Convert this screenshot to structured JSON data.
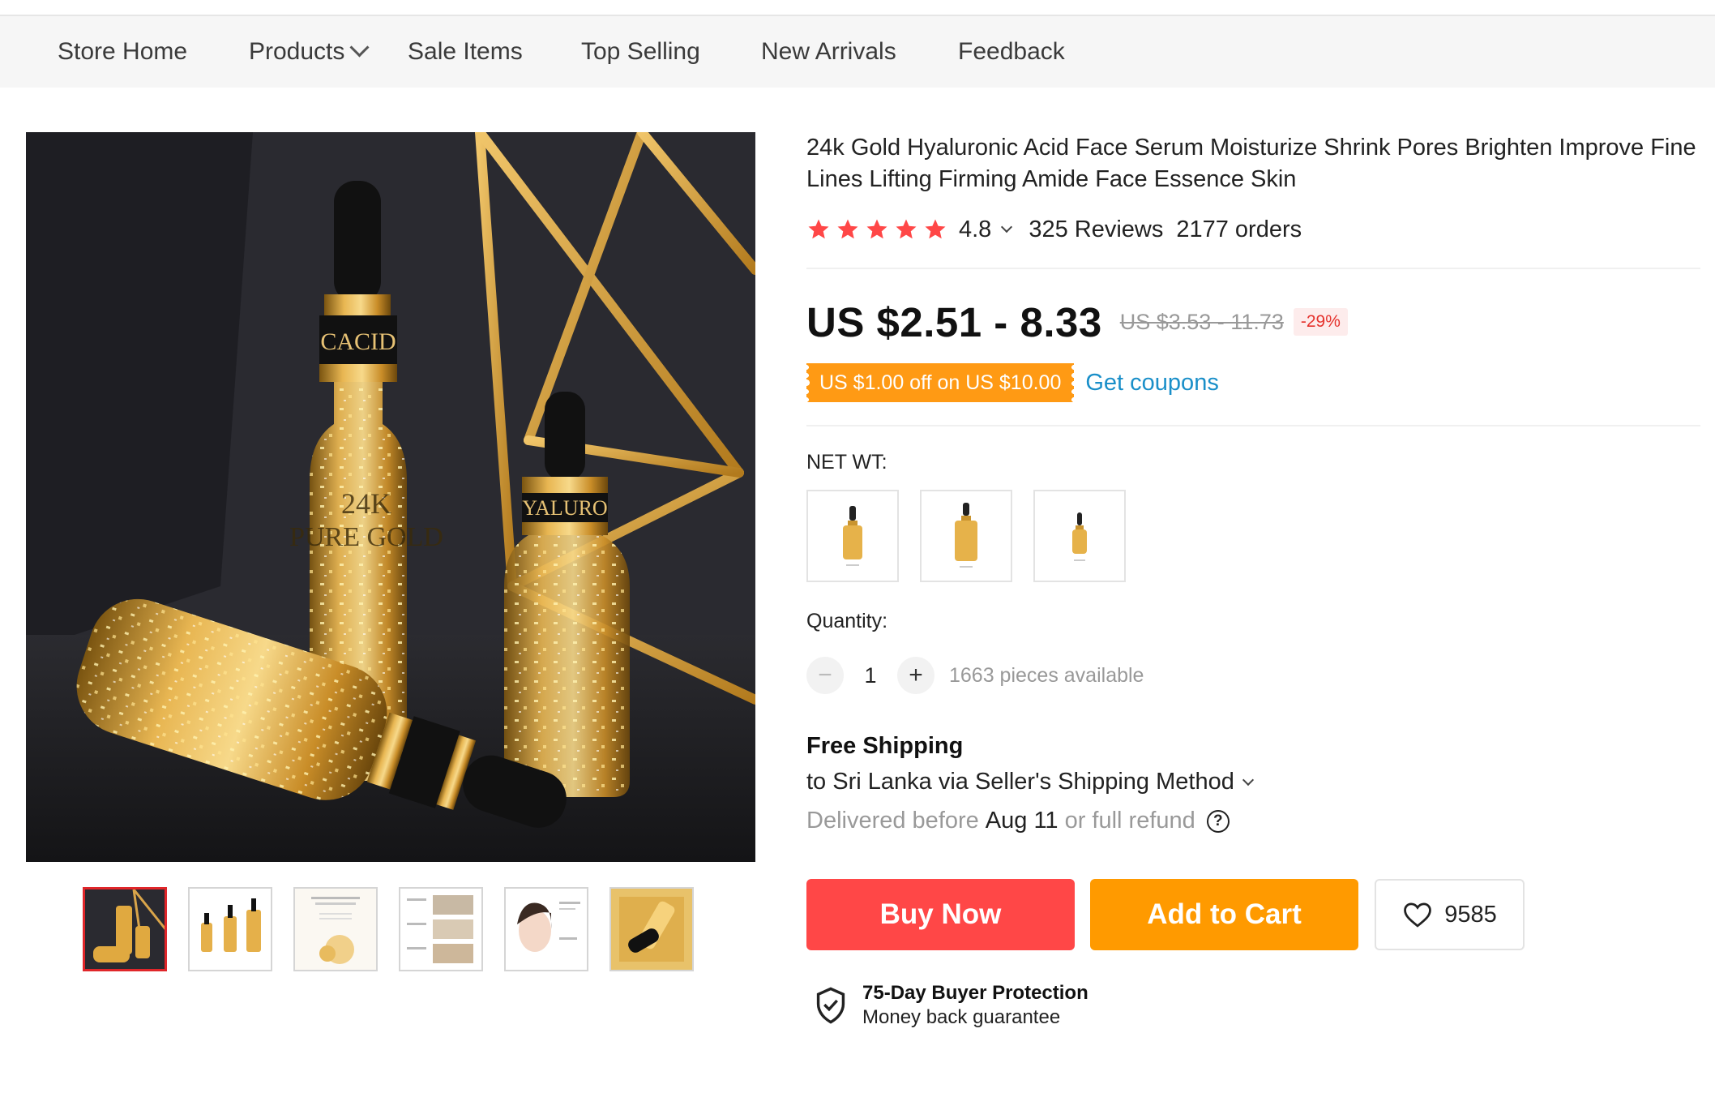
{
  "nav": {
    "items": [
      {
        "label": "Store Home"
      },
      {
        "label": "Products",
        "has_dropdown": true
      },
      {
        "label": "Sale Items"
      },
      {
        "label": "Top Selling"
      },
      {
        "label": "New Arrivals"
      },
      {
        "label": "Feedback"
      }
    ]
  },
  "gallery": {
    "main_image_label_text": [
      "CACID",
      "24K",
      "PURE GOLD",
      "YALURO"
    ],
    "thumbnail_count": 6,
    "active_thumbnail": 0
  },
  "product": {
    "title": "24k Gold Hyaluronic Acid Face Serum Moisturize Shrink Pores Brighten Improve Fine Lines Lifting Firming Amide Face Essence Skin",
    "rating": "4.8",
    "star_count": 5,
    "reviews": "325 Reviews",
    "orders": "2177 orders"
  },
  "price": {
    "current": "US $2.51 - 8.33",
    "original": "US $3.53 - 11.73",
    "discount": "-29%"
  },
  "coupon": {
    "text": "US $1.00 off on US $10.00",
    "link": "Get coupons"
  },
  "variants": {
    "label": "NET WT:",
    "options": [
      "sku-1",
      "sku-2",
      "sku-3"
    ]
  },
  "quantity": {
    "label": "Quantity:",
    "minus": "−",
    "value": "1",
    "plus": "+",
    "available": "1663 pieces available"
  },
  "shipping": {
    "title": "Free Shipping",
    "destination": "to Sri Lanka via Seller's Shipping Method",
    "delivery_prefix": "Delivered before",
    "delivery_date": "Aug 11",
    "delivery_suffix": "or full refund",
    "help": "?"
  },
  "actions": {
    "buy_now": "Buy Now",
    "add_to_cart": "Add to Cart",
    "wishlist_count": "9585"
  },
  "protection": {
    "title": "75-Day Buyer Protection",
    "subtitle": "Money back guarantee"
  },
  "colors": {
    "accent_red": "#ff4747",
    "accent_orange": "#ff9a00",
    "coupon_orange": "#ff9a14",
    "link_blue": "#1a8fc9",
    "star_red": "#ff4747"
  }
}
